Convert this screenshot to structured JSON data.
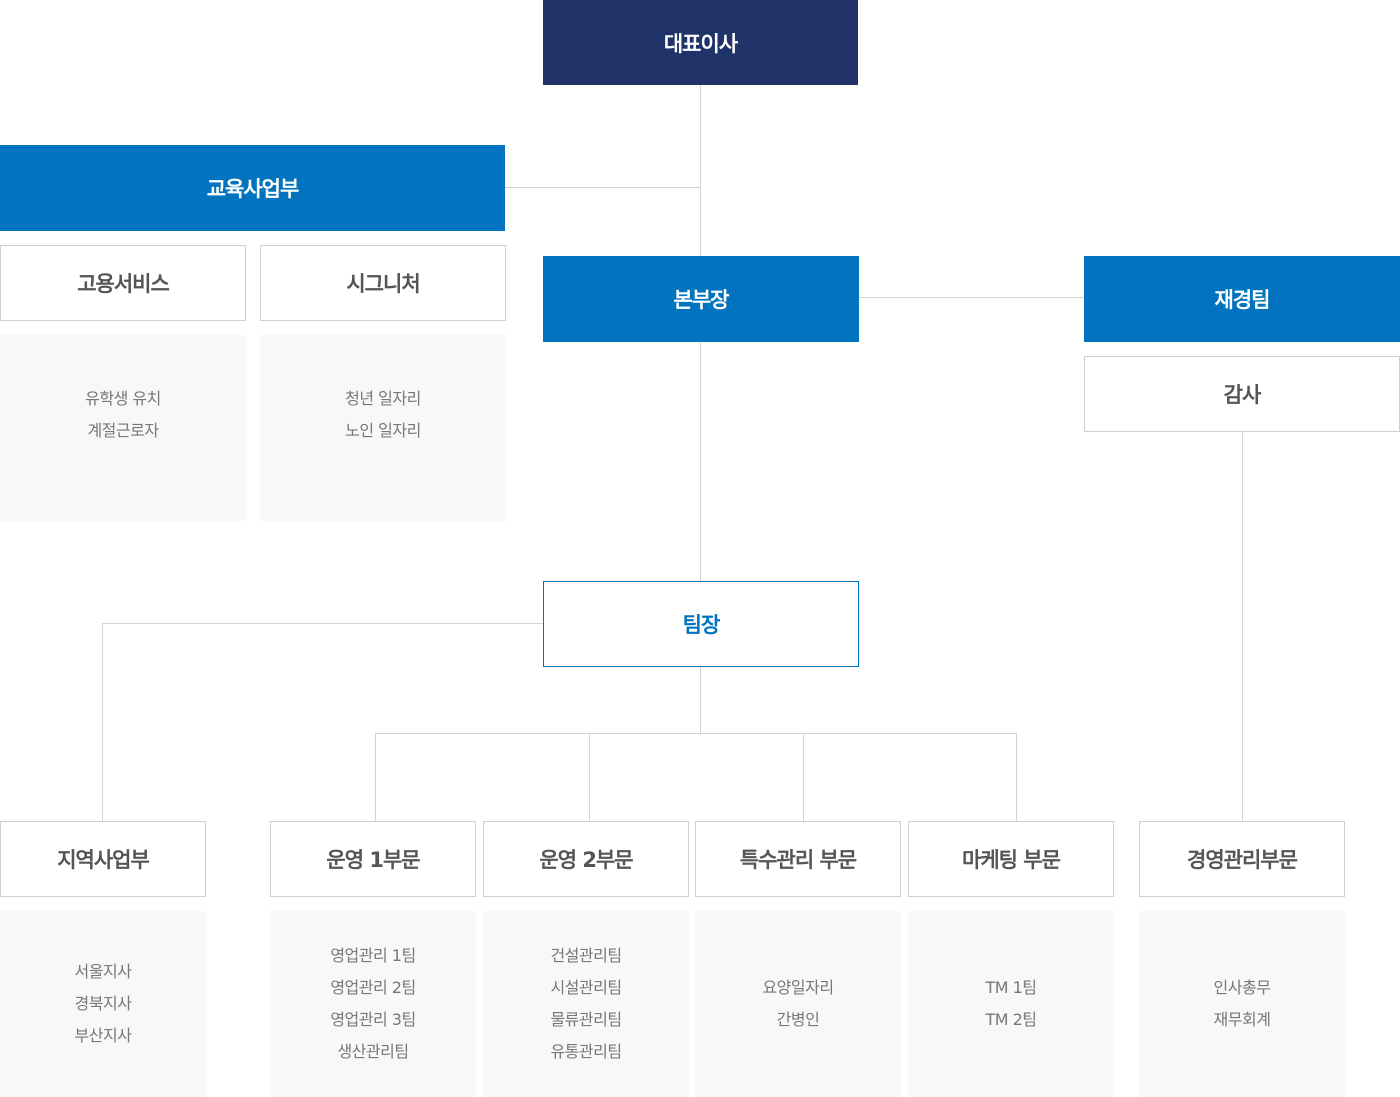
{
  "ceo": "대표이사",
  "education_division": {
    "title": "교육사업부",
    "units": [
      {
        "title": "고용서비스",
        "items": [
          "유학생 유치",
          "계절근로자"
        ]
      },
      {
        "title": "시그니처",
        "items": [
          "청년 일자리",
          "노인 일자리"
        ]
      }
    ]
  },
  "head": "본부장",
  "finance_team": "재경팀",
  "audit": "감사",
  "team_leader": "팀장",
  "divisions": [
    {
      "title": "지역사업부",
      "items": [
        "서울지사",
        "경북지사",
        "부산지사"
      ]
    },
    {
      "title": "운영 1부문",
      "items": [
        "영업관리 1팀",
        "영업관리 2팀",
        "영업관리 3팀",
        "생산관리팀"
      ]
    },
    {
      "title": "운영 2부문",
      "items": [
        "건설관리팀",
        "시설관리팀",
        "물류관리팀",
        "유통관리팀"
      ]
    },
    {
      "title": "특수관리 부문",
      "items": [
        "요양일자리",
        "간병인"
      ]
    },
    {
      "title": "마케팅 부문",
      "items": [
        "TM 1팀",
        "TM 2팀"
      ]
    },
    {
      "title": "경영관리부문",
      "items": [
        "인사총무",
        "재무회계"
      ]
    }
  ],
  "colors": {
    "navy": "#1f3368",
    "blue": "#0273be",
    "border": "#cfcfcf",
    "panel": "#f8f8f8",
    "line": "#d4d4d4"
  }
}
